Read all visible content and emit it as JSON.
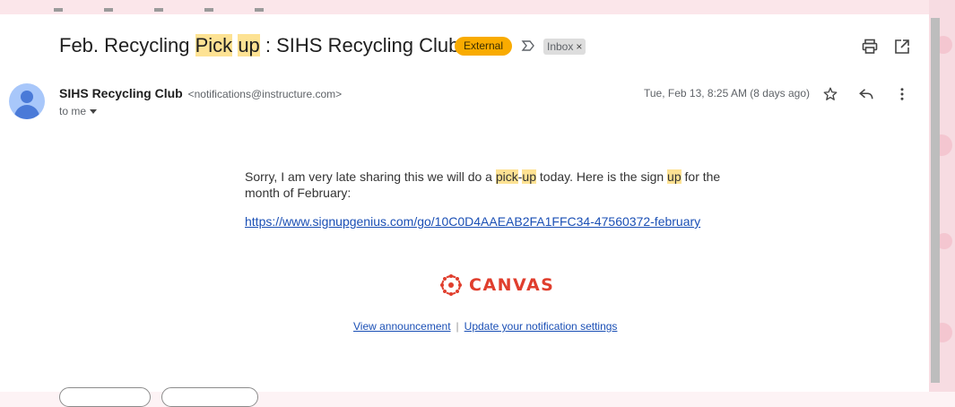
{
  "email": {
    "subject_parts": [
      "Feb. Recycling ",
      "Pick",
      " ",
      "up",
      " : SIHS Recycling Club"
    ],
    "external_badge": "External",
    "label_chip": "Inbox",
    "label_remove": "×",
    "sender": {
      "name": "SIHS Recycling Club",
      "email": "<notifications@instructure.com>",
      "recipient": "to me"
    },
    "date": "Tue, Feb 13, 8:25 AM (8 days ago)",
    "body": {
      "segments": [
        "Sorry, I am very late sharing this we will do a ",
        "pick",
        "-",
        "up",
        " today. Here is the sign ",
        "up",
        " for the month of February:"
      ],
      "link": "https://www.signupgenius.com/go/10C0D4AAEAB2FA1FFC34-47560372-february"
    },
    "brand": "CANVAS",
    "footer": {
      "view_announcement": "View announcement",
      "separator": "|",
      "update_settings": "Update your notification settings"
    }
  },
  "colors": {
    "highlight": "#fde293",
    "external": "#f9ab00",
    "canvas_red": "#e03e2d",
    "link_blue": "#1a4fb5"
  },
  "icons": [
    "important-marker-icon",
    "print-icon",
    "open-in-new-window-icon",
    "star-icon",
    "reply-icon",
    "more-vert-icon",
    "canvas-logo-icon",
    "person-icon"
  ]
}
